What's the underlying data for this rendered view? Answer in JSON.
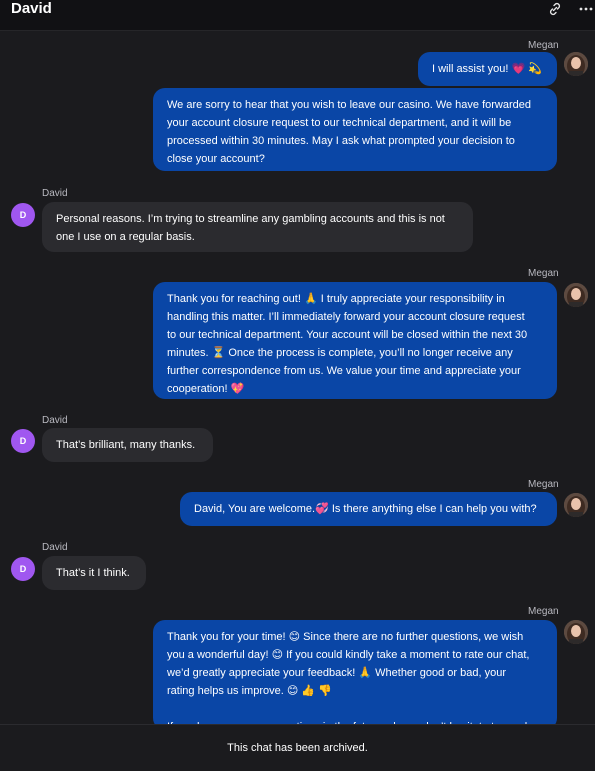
{
  "header": {
    "title": "David",
    "icons": [
      "link-icon",
      "more-horizontal-icon"
    ]
  },
  "messages": [
    {
      "sender": "Megan",
      "direction": "outgoing",
      "show_sender": true,
      "text": "I will assist you! 💗 💫"
    },
    {
      "sender": "Megan",
      "direction": "outgoing",
      "show_sender": false,
      "lines": [
        "We are sorry to hear that you wish to leave our casino. We have forwarded",
        "your account closure request to our technical department, and it will be",
        "processed within 30 minutes. May I ask what prompted your decision to",
        "close your account?"
      ]
    },
    {
      "sender": "David",
      "avatar_letter": "D",
      "direction": "incoming",
      "show_sender": true,
      "lines": [
        "Personal reasons. I’m trying to streamline any gambling accounts and this is not",
        "one I use on a regular basis."
      ]
    },
    {
      "sender": "Megan",
      "direction": "outgoing",
      "show_sender": true,
      "lines": [
        "Thank you for reaching out! 🙏 I truly appreciate your responsibility in",
        "handling this matter. I’ll immediately forward your account closure request",
        "to our technical department. Your account will be closed within the next 30",
        "minutes. ⏳ Once the process is complete, you’ll no longer receive any",
        "further correspondence from us. We value your time and appreciate your",
        "cooperation! 💖"
      ]
    },
    {
      "sender": "David",
      "avatar_letter": "D",
      "direction": "incoming",
      "show_sender": true,
      "text": "That’s brilliant, many thanks."
    },
    {
      "sender": "Megan",
      "direction": "outgoing",
      "show_sender": true,
      "text": "David, You are welcome.💞 Is there anything else I can help you with?"
    },
    {
      "sender": "David",
      "avatar_letter": "D",
      "direction": "incoming",
      "show_sender": true,
      "text": "That’s it I think."
    },
    {
      "sender": "Megan",
      "direction": "outgoing",
      "show_sender": true,
      "lines": [
        "Thank you for your time! 😊 Since there are no further questions, we wish",
        "you a wonderful day! 😊 If you could kindly take a moment to rate our chat,",
        "we’d greatly appreciate your feedback! 🙏 Whether good or bad, your",
        "rating helps us improve. 😊 👍 👎",
        "",
        "If you have any more questions in the future, please don’t hesitate to reach"
      ]
    }
  ],
  "footer": {
    "text": "This chat has been archived."
  },
  "colors": {
    "background": "#1b1b1e",
    "outgoing_bubble": "#0a46a6",
    "incoming_bubble": "#2b2b2f",
    "avatar_incoming": "#a057f0"
  }
}
